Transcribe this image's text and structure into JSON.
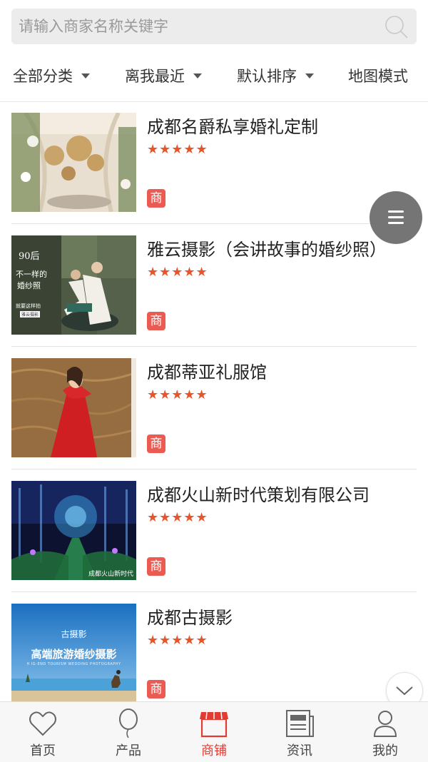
{
  "search": {
    "placeholder": "请输入商家名称关键字"
  },
  "filters": [
    {
      "label": "全部分类",
      "has_arrow": true
    },
    {
      "label": "离我最近",
      "has_arrow": true
    },
    {
      "label": "默认排序",
      "has_arrow": true
    },
    {
      "label": "地图模式",
      "has_arrow": false
    }
  ],
  "merchants": [
    {
      "name": "成都名爵私享婚礼定制",
      "stars": "★★★★★",
      "badge": "商"
    },
    {
      "name": "雅云摄影（会讲故事的婚纱照）",
      "stars": "★★★★★",
      "badge": "商",
      "image_text": {
        "line1": "90后",
        "line2": "不一样的",
        "line3": "婚纱照",
        "line4": "就要这样拍",
        "line5": "雅云摄影"
      }
    },
    {
      "name": "成都蒂亚礼服馆",
      "stars": "★★★★★",
      "badge": "商"
    },
    {
      "name": "成都火山新时代策划有限公司",
      "stars": "★★★★★",
      "badge": "商",
      "image_text": {
        "caption": "成都火山新时代"
      }
    },
    {
      "name": "成都古摄影",
      "stars": "★★★★★",
      "badge": "商",
      "image_text": {
        "brand": "古摄影",
        "headline": "高端旅游婚纱摄影",
        "sub": "H IG-END TOURISM WEDDING PHOTOGRAPHY"
      }
    }
  ],
  "tabs": [
    {
      "label": "首页",
      "icon": "heart-icon",
      "active": false
    },
    {
      "label": "产品",
      "icon": "balloon-icon",
      "active": false
    },
    {
      "label": "商铺",
      "icon": "shop-icon",
      "active": true
    },
    {
      "label": "资讯",
      "icon": "news-icon",
      "active": false
    },
    {
      "label": "我的",
      "icon": "user-icon",
      "active": false
    }
  ],
  "colors": {
    "accent": "#e23b34",
    "star": "#e8542b",
    "badge": "#ec5b52"
  }
}
